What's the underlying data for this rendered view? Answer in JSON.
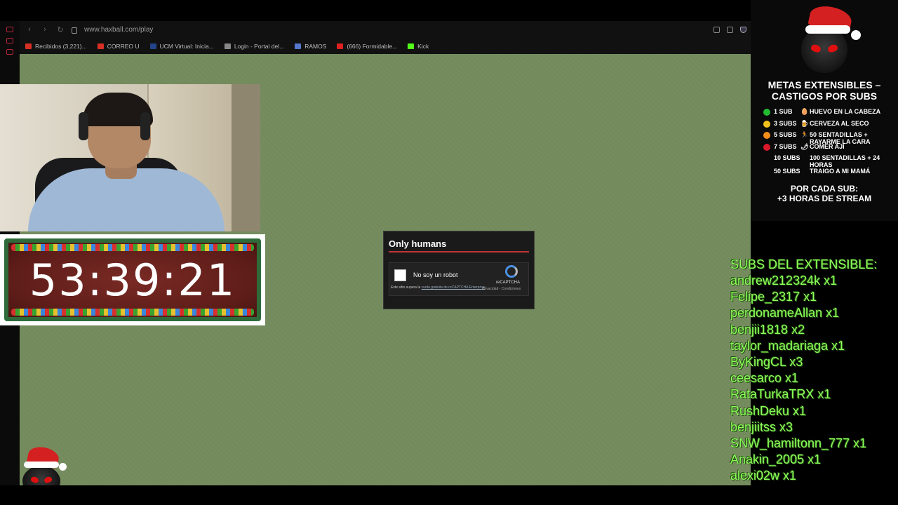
{
  "browser": {
    "url": "www.haxball.com/play",
    "bookmarks": [
      {
        "label": "Recibidos (3,221)...",
        "color": "#d93025"
      },
      {
        "label": "CORREO U",
        "color": "#d93025"
      },
      {
        "label": "UCM Virtual: Inicia...",
        "color": "#224488"
      },
      {
        "label": "Login - Portal del...",
        "color": "#888888"
      },
      {
        "label": "RAMOS",
        "color": "#5577cc"
      },
      {
        "label": "(666) Formidable...",
        "color": "#e02020"
      },
      {
        "label": "Kick",
        "color": "#53fc18"
      }
    ]
  },
  "timer": {
    "value": "53:39:21"
  },
  "captcha": {
    "title": "Only humans",
    "checkbox_label": "No soy un robot",
    "brand": "reCAPTCHA",
    "terms": "Privacidad - Condiciones",
    "notice": "Este sitio supera la",
    "notice_link": "cuota gratuita de reCAPTCHA Enterprise"
  },
  "goals": {
    "title": "METAS EXTENSIBLES – CASTIGOS POR SUBS",
    "items": [
      {
        "count": "1 SUB",
        "icon": "egg-icon",
        "glyph": "🥚",
        "desc": "HUEVO EN LA CABEZA",
        "dot": "#22bb33"
      },
      {
        "count": "3 SUBS",
        "icon": "beer-icon",
        "glyph": "🍺",
        "desc": "CERVEZA AL SECO",
        "dot": "#f2c21b"
      },
      {
        "count": "5 SUBS",
        "icon": "running-icon",
        "glyph": "🏃",
        "desc": "50 SENTADILLAS + RAYARME LA CARA",
        "dot": "#f28c1b"
      },
      {
        "count": "7 SUBS",
        "icon": "chili-icon",
        "glyph": "🌶",
        "desc": "COMER AJÍ",
        "dot": "#d9192b"
      },
      {
        "count": "10 SUBS",
        "icon": "",
        "glyph": "",
        "desc": "100 SENTADILLAS + 24 HORAS",
        "dot": ""
      },
      {
        "count": "50 SUBS",
        "icon": "",
        "glyph": "",
        "desc": "TRAIGO A MI MAMÁ",
        "dot": ""
      }
    ],
    "footer_line1": "POR CADA SUB:",
    "footer_line2": "+3 HORAS DE STREAM"
  },
  "subs": {
    "header": "SUBS DEL EXTENSIBLE:",
    "list": [
      "andrew212324k x1",
      "Felipe_2317 x1",
      "perdonameAllan x1",
      "benjii1818 x2",
      "taylor_madariaga x1",
      "ByKingCL x3",
      "ceesarco x1",
      "RataTurkaTRX x1",
      "RushDeku x1",
      "benjiitss x3",
      "SNW_hamiltonn_777 x1",
      "Anakin_2005 x1",
      "alexi02w x1"
    ]
  }
}
